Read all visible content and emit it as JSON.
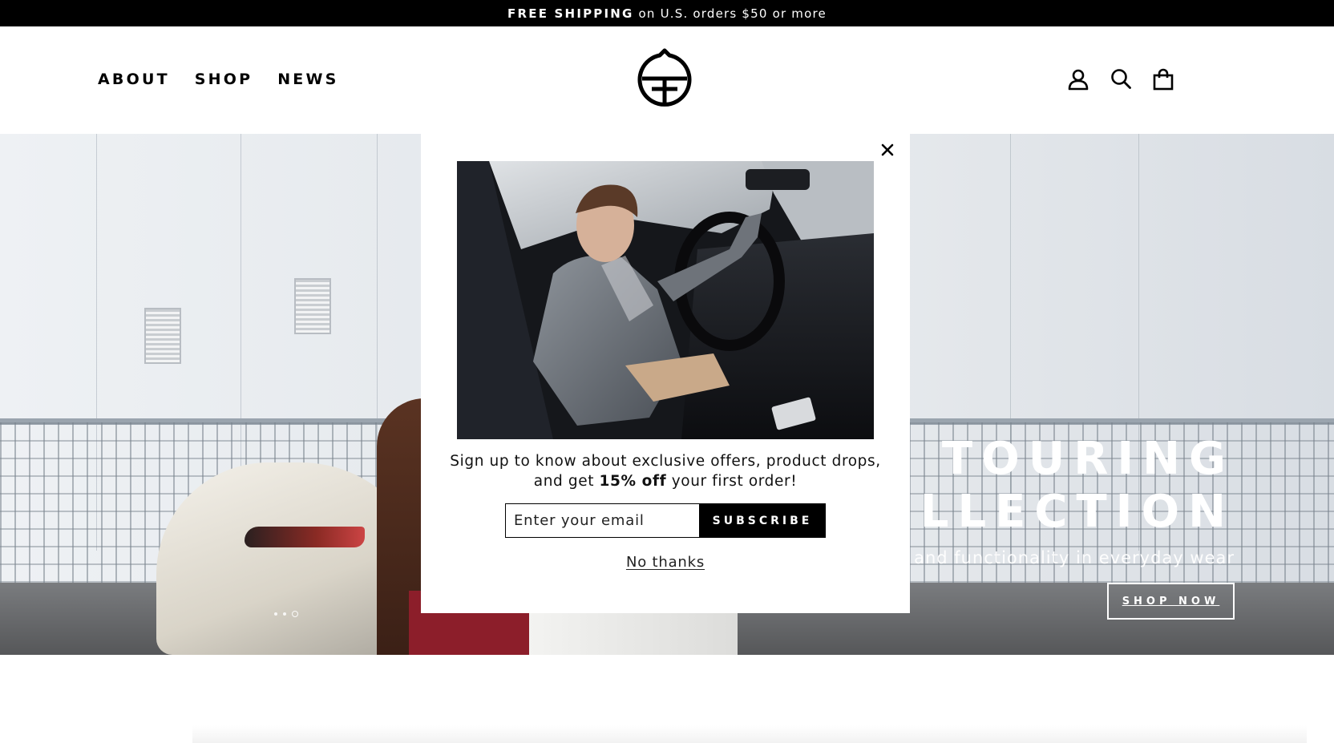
{
  "announcement": {
    "bold": "FREE SHIPPING",
    "rest": "on U.S. orders $50 or more"
  },
  "nav": {
    "items": [
      {
        "label": "ABOUT"
      },
      {
        "label": "SHOP"
      },
      {
        "label": "NEWS"
      }
    ]
  },
  "header": {
    "logo_icon": "brand-emblem",
    "icons": [
      "account-icon",
      "search-icon",
      "cart-icon"
    ]
  },
  "hero": {
    "title": "TOURING\nCOLLECTION",
    "subtitle": "Style and functionality in everyday wear",
    "button_label": "SHOP NOW"
  },
  "popup": {
    "text_line1": "Sign up to know about exclusive offers, product drops,",
    "text_prefix": "and get",
    "text_bold": "15% off",
    "text_suffix": "your first order!",
    "email_placeholder": "Enter your email",
    "subscribe_label": "SUBSCRIBE",
    "dismiss_label": "No thanks",
    "close_icon": "close-icon"
  },
  "colors": {
    "announcement_bg": "#000000",
    "button_bg": "#000000",
    "text": "#000000"
  }
}
